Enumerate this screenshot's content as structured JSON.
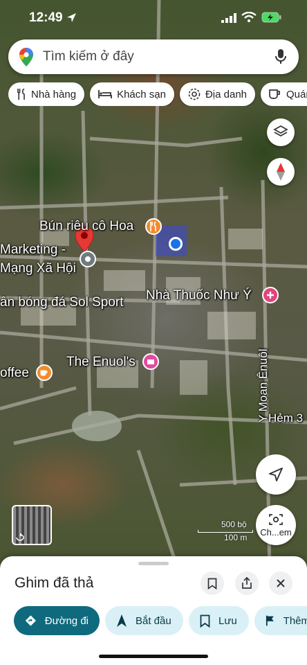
{
  "status_bar": {
    "time": "12:49"
  },
  "search": {
    "placeholder": "Tìm kiếm ở đây"
  },
  "chips": [
    {
      "label": "Nhà hàng",
      "icon": "fork-knife-icon"
    },
    {
      "label": "Khách sạn",
      "icon": "bed-icon"
    },
    {
      "label": "Địa danh",
      "icon": "landmark-icon"
    },
    {
      "label": "Quán c",
      "icon": "coffee-cup-icon"
    }
  ],
  "map_labels": {
    "bun_rieu": "Bún riêu cô Hoa",
    "marketing_line1": "Marketing -",
    "marketing_line2": "Mạng Xã Hội",
    "sol_sport": "ân bóng đá Sol Sport",
    "nha_thuoc": "Nhà Thuốc Như Ý",
    "enuol": "The Enuol's",
    "coffee": "offee",
    "y_moan_enuol": "Y Moan Ênuôl",
    "hem": "Hẻm 3"
  },
  "scale": {
    "top": "500 bộ",
    "bottom": "100 m"
  },
  "controls": {
    "camera_label": "Ch...em"
  },
  "sheet": {
    "title": "Ghim đã thả",
    "actions": [
      {
        "label": "Đường đi",
        "icon": "directions-icon"
      },
      {
        "label": "Bắt đầu",
        "icon": "navigation-arrow-icon"
      },
      {
        "label": "Lưu",
        "icon": "bookmark-icon"
      },
      {
        "label": "Thêm",
        "icon": "flag-icon"
      }
    ]
  },
  "colors": {
    "primary_action": "#0f6a7e",
    "secondary_action": "#d9f0f6",
    "pin_red": "#e53935",
    "poi_orange": "#f08c2e",
    "poi_pink": "#e04ba0",
    "location_blue": "#1a73e8"
  }
}
